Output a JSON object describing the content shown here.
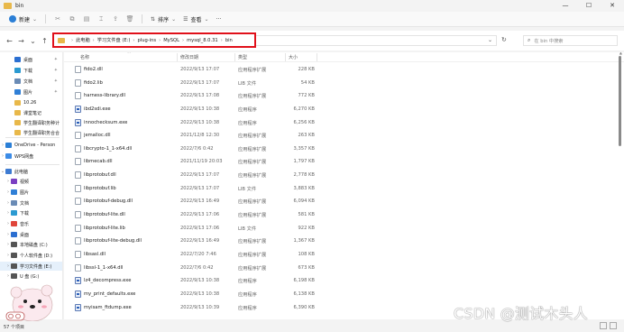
{
  "window": {
    "title": "bin",
    "controls": [
      "—",
      "☐",
      "✕"
    ]
  },
  "toolbar": {
    "new_label": "新建",
    "sort_label": "排序",
    "view_label": "查看",
    "more_label": "···"
  },
  "address": {
    "crumbs": [
      "此电脑",
      "学习文件盘 (E:)",
      "plug-ins",
      "MySQL",
      "mysql_8.0.31",
      "bin"
    ],
    "search_placeholder": "在 bin 中搜索"
  },
  "sidebar": {
    "items": [
      {
        "label": "桌面",
        "icon": "desktop-icon",
        "color": "#2b6fd1",
        "pinned": true
      },
      {
        "label": "下载",
        "icon": "download-icon",
        "color": "#2b9ad1",
        "pinned": true
      },
      {
        "label": "文档",
        "icon": "document-icon",
        "color": "#6a8bb5",
        "pinned": true
      },
      {
        "label": "图片",
        "icon": "pictures-icon",
        "color": "#2f7fd6",
        "pinned": true
      },
      {
        "label": "10.26",
        "icon": "folder-icon",
        "color": "#e8b84a",
        "pinned": false
      },
      {
        "label": "课堂笔记",
        "icon": "folder-icon",
        "color": "#e8b84a",
        "pinned": false
      },
      {
        "label": "学生翻译职务种计",
        "icon": "folder-icon",
        "color": "#e8b84a",
        "pinned": false
      },
      {
        "label": "学生翻译职务合合",
        "icon": "folder-icon",
        "color": "#e8b84a",
        "pinned": false
      },
      {
        "label": "OneDrive - Person",
        "icon": "cloud-icon",
        "color": "#2b7fd6",
        "pinned": false
      },
      {
        "label": "WPS网盘",
        "icon": "cloud-icon",
        "color": "#3b8be6",
        "pinned": false
      },
      {
        "label": "此电脑",
        "icon": "computer-icon",
        "color": "#3d7bd2",
        "pinned": false
      },
      {
        "label": "视频",
        "icon": "video-icon",
        "color": "#7a3fc2",
        "pinned": false
      },
      {
        "label": "图片",
        "icon": "pictures-icon",
        "color": "#2f7fd6",
        "pinned": false
      },
      {
        "label": "文档",
        "icon": "document-icon",
        "color": "#6a8bb5",
        "pinned": false
      },
      {
        "label": "下载",
        "icon": "download-icon",
        "color": "#2b9ad1",
        "pinned": false
      },
      {
        "label": "音乐",
        "icon": "music-icon",
        "color": "#e0453a",
        "pinned": false
      },
      {
        "label": "桌面",
        "icon": "desktop-icon",
        "color": "#2b6fd1",
        "pinned": false
      },
      {
        "label": "本地磁盘 (C:)",
        "icon": "drive-icon",
        "color": "#555555",
        "pinned": false
      },
      {
        "label": "个人软件盘 (D:)",
        "icon": "drive-icon",
        "color": "#555555",
        "pinned": false
      },
      {
        "label": "学习文件盘 (E:)",
        "icon": "drive-icon",
        "color": "#555555",
        "pinned": false
      },
      {
        "label": "U 盘 (G:)",
        "icon": "drive-icon",
        "color": "#555555",
        "pinned": false
      }
    ]
  },
  "columns": {
    "name": "名称",
    "date": "修改日期",
    "type": "类型",
    "size": "大小"
  },
  "files": [
    {
      "name": "fido2.dll",
      "date": "2022/9/13 17:07",
      "type": "应用程序扩展",
      "size": "228 KB",
      "kind": "dll"
    },
    {
      "name": "fido2.lib",
      "date": "2022/9/13 17:07",
      "type": "LIB 文件",
      "size": "54 KB",
      "kind": "lib"
    },
    {
      "name": "harness-library.dll",
      "date": "2022/9/13 17:08",
      "type": "应用程序扩展",
      "size": "772 KB",
      "kind": "dll"
    },
    {
      "name": "ibd2sdi.exe",
      "date": "2022/9/13 10:38",
      "type": "应用程序",
      "size": "6,270 KB",
      "kind": "exe"
    },
    {
      "name": "innochecksum.exe",
      "date": "2022/9/13 10:38",
      "type": "应用程序",
      "size": "6,256 KB",
      "kind": "exe"
    },
    {
      "name": "jemalloc.dll",
      "date": "2021/12/8 12:30",
      "type": "应用程序扩展",
      "size": "263 KB",
      "kind": "dll"
    },
    {
      "name": "libcrypto-1_1-x64.dll",
      "date": "2022/7/6 0:42",
      "type": "应用程序扩展",
      "size": "3,357 KB",
      "kind": "dll"
    },
    {
      "name": "libmecab.dll",
      "date": "2021/11/19 20:03",
      "type": "应用程序扩展",
      "size": "1,797 KB",
      "kind": "dll"
    },
    {
      "name": "libprotobuf.dll",
      "date": "2022/9/13 17:07",
      "type": "应用程序扩展",
      "size": "2,778 KB",
      "kind": "dll"
    },
    {
      "name": "libprotobuf.lib",
      "date": "2022/9/13 17:07",
      "type": "LIB 文件",
      "size": "3,883 KB",
      "kind": "lib"
    },
    {
      "name": "libprotobuf-debug.dll",
      "date": "2022/9/13 16:49",
      "type": "应用程序扩展",
      "size": "6,094 KB",
      "kind": "dll"
    },
    {
      "name": "libprotobuf-lite.dll",
      "date": "2022/9/13 17:06",
      "type": "应用程序扩展",
      "size": "581 KB",
      "kind": "dll"
    },
    {
      "name": "libprotobuf-lite.lib",
      "date": "2022/9/13 17:06",
      "type": "LIB 文件",
      "size": "922 KB",
      "kind": "lib"
    },
    {
      "name": "libprotobuf-lite-debug.dll",
      "date": "2022/9/13 16:49",
      "type": "应用程序扩展",
      "size": "1,367 KB",
      "kind": "dll"
    },
    {
      "name": "libsasl.dll",
      "date": "2022/7/20 7:46",
      "type": "应用程序扩展",
      "size": "108 KB",
      "kind": "dll"
    },
    {
      "name": "libssl-1_1-x64.dll",
      "date": "2022/7/6 0:42",
      "type": "应用程序扩展",
      "size": "673 KB",
      "kind": "dll"
    },
    {
      "name": "lz4_decompress.exe",
      "date": "2022/9/13 10:38",
      "type": "应用程序",
      "size": "6,198 KB",
      "kind": "exe"
    },
    {
      "name": "my_print_defaults.exe",
      "date": "2022/9/13 10:38",
      "type": "应用程序",
      "size": "6,138 KB",
      "kind": "exe"
    },
    {
      "name": "myisam_ftdump.exe",
      "date": "2022/9/13 10:39",
      "type": "应用程序",
      "size": "6,390 KB",
      "kind": "exe"
    }
  ],
  "status": {
    "count": "57 个项目"
  },
  "watermark": "CSDN @测试木头人"
}
